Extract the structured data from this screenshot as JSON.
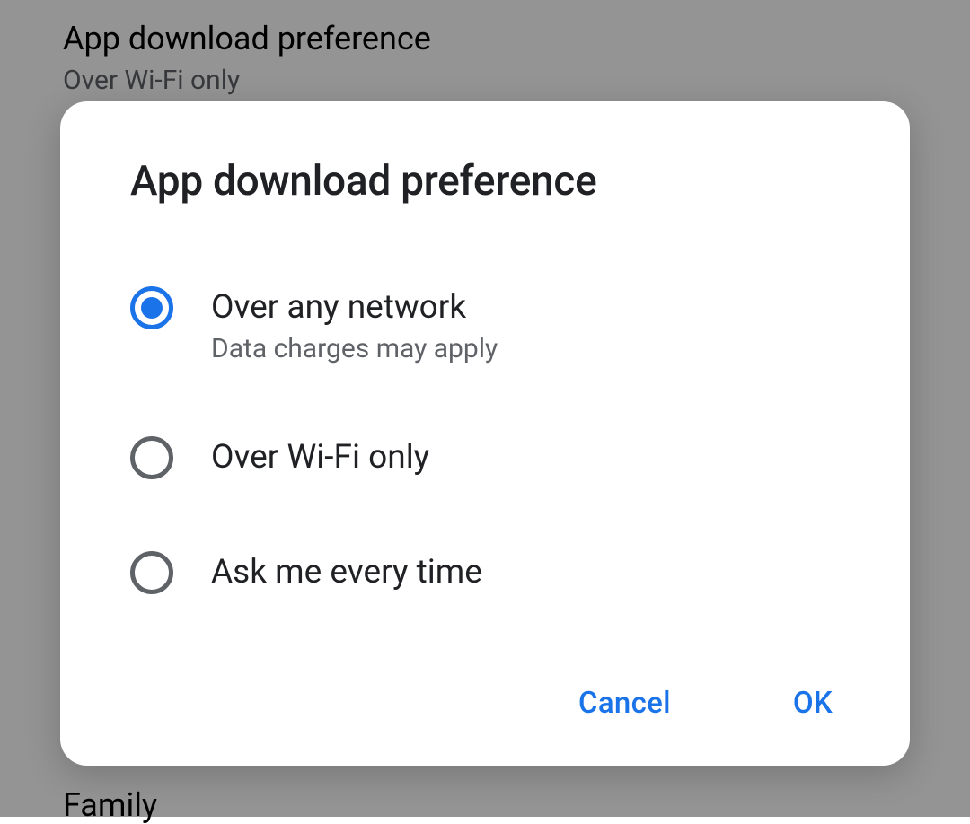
{
  "background": {
    "setting_title": "App download preference",
    "setting_value": "Over Wi-Fi only",
    "bottom_text": "Family"
  },
  "dialog": {
    "title": "App download preference",
    "options": [
      {
        "label": "Over any network",
        "sublabel": "Data charges may apply",
        "selected": true
      },
      {
        "label": "Over Wi-Fi only",
        "sublabel": "",
        "selected": false
      },
      {
        "label": "Ask me every time",
        "sublabel": "",
        "selected": false
      }
    ],
    "actions": {
      "cancel": "Cancel",
      "ok": "OK"
    }
  },
  "colors": {
    "accent": "#1a73e8",
    "text_primary": "#202124",
    "text_secondary": "#5f6368"
  }
}
